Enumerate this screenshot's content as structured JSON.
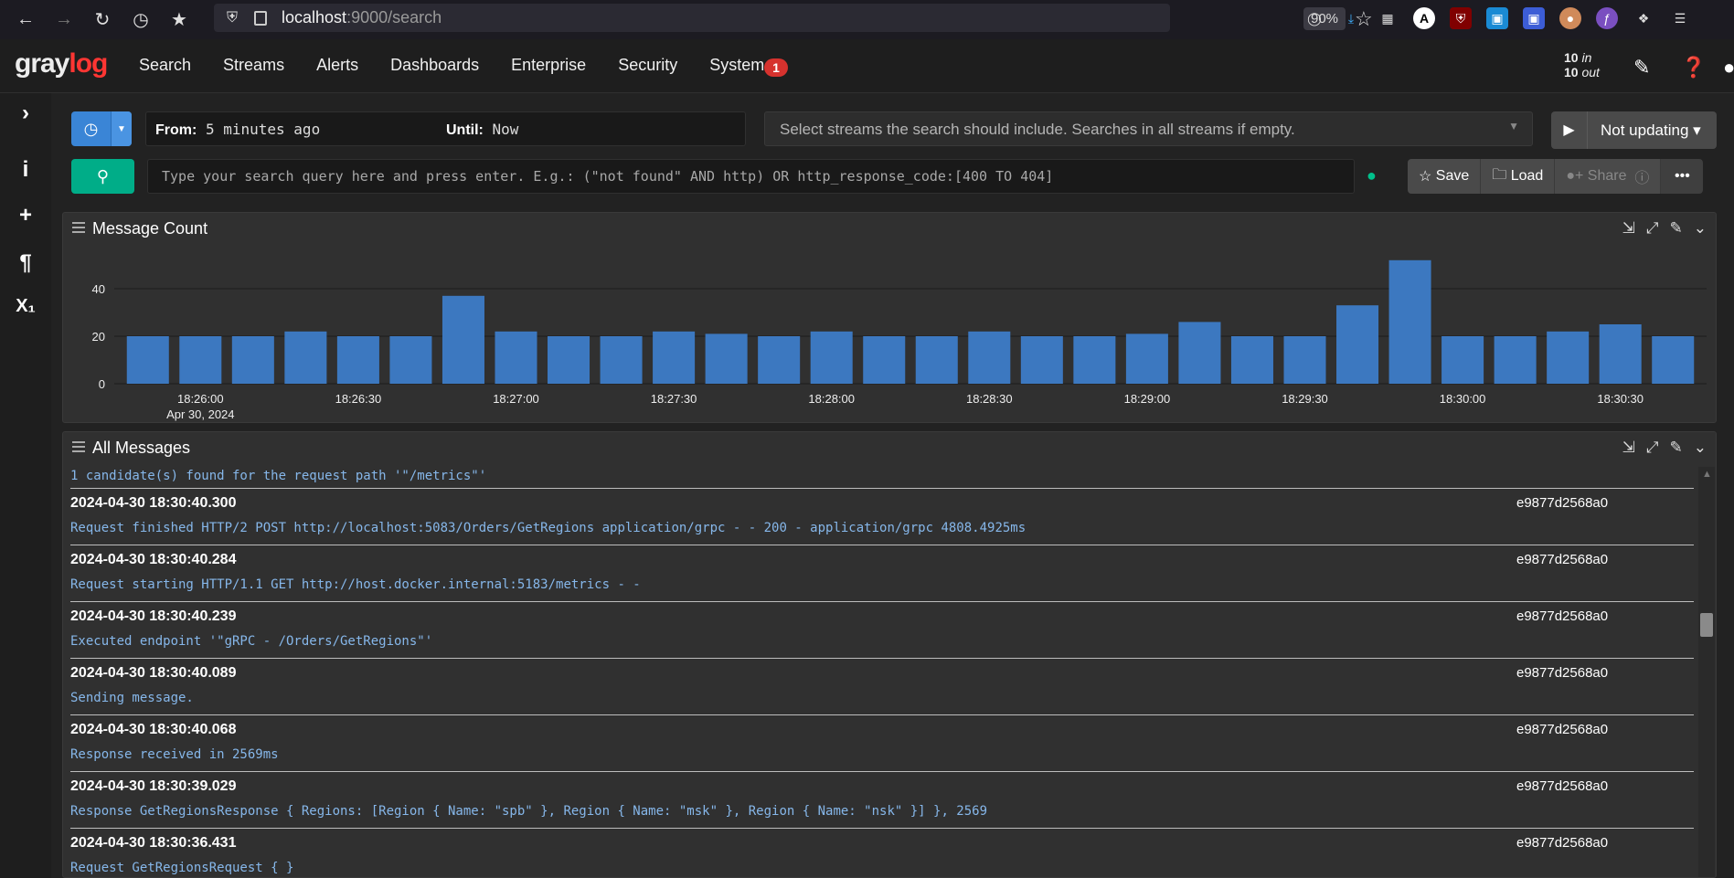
{
  "browser": {
    "url_host": "localhost",
    "url_rest": ":9000/search",
    "zoom": "90%"
  },
  "nav": {
    "logo_gray": "gray",
    "logo_log": "log",
    "items": [
      "Search",
      "Streams",
      "Alerts",
      "Dashboards",
      "Enterprise",
      "Security",
      "System ▾"
    ],
    "notification_count": "1",
    "throughput_in_value": "10",
    "throughput_in_label": "in",
    "throughput_out_value": "10",
    "throughput_out_label": "out"
  },
  "search": {
    "from_label": "From:",
    "from_value": "5 minutes ago",
    "until_label": "Until:",
    "until_value": "Now",
    "streams_placeholder": "Select streams the search should include. Searches in all streams if empty.",
    "update_label": "Not updating ▾",
    "query_placeholder": "Type your search query here and press enter. E.g.: (\"not found\" AND http) OR http_response_code:[400 TO 404]",
    "save_label": "Save",
    "load_label": "Load",
    "share_label": "Share"
  },
  "chart_panel": {
    "title": "Message Count"
  },
  "chart_data": {
    "type": "bar",
    "title": "Message Count",
    "xlabel": "",
    "ylabel": "",
    "ylim": [
      0,
      55
    ],
    "yticks": [
      0,
      20,
      40
    ],
    "x_tick_labels": [
      "18:26:00",
      "18:26:30",
      "18:27:00",
      "18:27:30",
      "18:28:00",
      "18:28:30",
      "18:29:00",
      "18:29:30",
      "18:30:00",
      "18:30:30"
    ],
    "x_date_label": "Apr 30, 2024",
    "values": [
      20,
      20,
      20,
      22,
      20,
      20,
      37,
      22,
      20,
      20,
      22,
      21,
      20,
      22,
      20,
      20,
      22,
      20,
      20,
      21,
      26,
      20,
      20,
      33,
      52,
      20,
      20,
      22,
      25,
      20
    ],
    "color": "#3c78c0",
    "grid": true
  },
  "messages_panel": {
    "title": "All Messages",
    "first_line": "1 candidate(s) found for the request path '\"/metrics\"'",
    "rows": [
      {
        "timestamp": "2024-04-30 18:30:40.300",
        "source": "e9877d2568a0",
        "message": "Request finished HTTP/2 POST http://localhost:5083/Orders/GetRegions application/grpc - - 200 - application/grpc 4808.4925ms"
      },
      {
        "timestamp": "2024-04-30 18:30:40.284",
        "source": "e9877d2568a0",
        "message": "Request starting HTTP/1.1 GET http://host.docker.internal:5183/metrics - -"
      },
      {
        "timestamp": "2024-04-30 18:30:40.239",
        "source": "e9877d2568a0",
        "message": "Executed endpoint '\"gRPC - /Orders/GetRegions\"'"
      },
      {
        "timestamp": "2024-04-30 18:30:40.089",
        "source": "e9877d2568a0",
        "message": "Sending message."
      },
      {
        "timestamp": "2024-04-30 18:30:40.068",
        "source": "e9877d2568a0",
        "message": "Response received in 2569ms"
      },
      {
        "timestamp": "2024-04-30 18:30:39.029",
        "source": "e9877d2568a0",
        "message": "Response GetRegionsResponse { Regions: [Region { Name: \"spb\" }, Region { Name: \"msk\" }, Region { Name: \"nsk\" }] }, 2569"
      },
      {
        "timestamp": "2024-04-30 18:30:36.431",
        "source": "e9877d2568a0",
        "message": "Request GetRegionsRequest { }"
      }
    ]
  }
}
